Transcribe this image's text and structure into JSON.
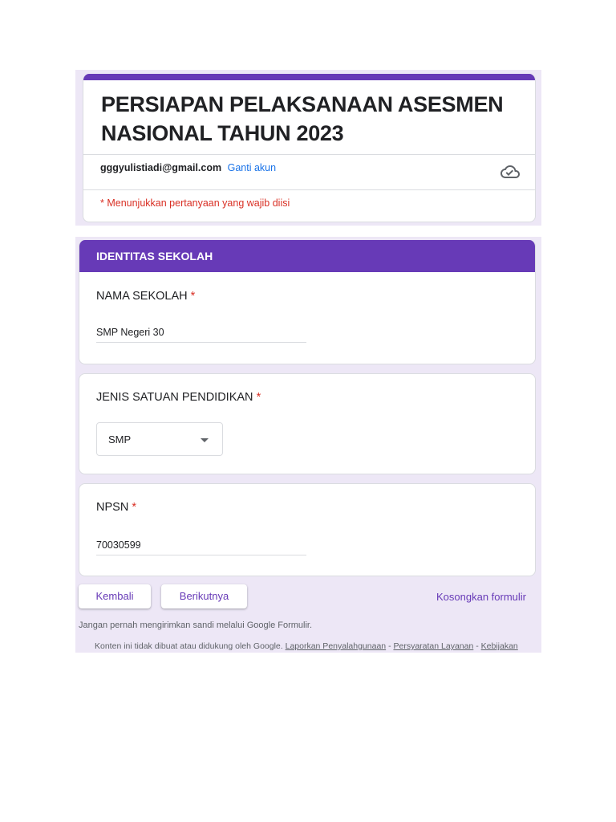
{
  "colors": {
    "accent": "#673ab7",
    "required": "#d93025",
    "link": "#1a73e8",
    "background": "#ede7f6"
  },
  "form": {
    "title": "PERSIAPAN PELAKSANAAN ASESMEN NASIONAL TAHUN 2023",
    "account_email": "gggyulistiadi@gmail.com",
    "switch_account": "Ganti akun",
    "required_note": "* Menunjukkan pertanyaan yang wajib diisi",
    "cloud_icon": "cloud-check-icon"
  },
  "section": {
    "title": "IDENTITAS SEKOLAH",
    "questions": [
      {
        "label": "NAMA SEKOLAH",
        "required_mark": "*",
        "value": "SMP Negeri 30"
      },
      {
        "label": "JENIS SATUAN PENDIDIKAN",
        "required_mark": "*",
        "value": "SMP"
      },
      {
        "label": "NPSN",
        "required_mark": "*",
        "value": "70030599"
      }
    ]
  },
  "nav": {
    "back": "Kembali",
    "next": "Berikutnya",
    "clear": "Kosongkan formulir"
  },
  "footer": {
    "password_warning": "Jangan pernah mengirimkan sandi melalui Google Formulir.",
    "disclaimer": "Konten ini tidak dibuat atau didukung oleh Google.",
    "links": [
      "Laporkan Penyalahgunaan",
      "Persyaratan Layanan",
      "Kebijakan"
    ],
    "separator": "-"
  }
}
